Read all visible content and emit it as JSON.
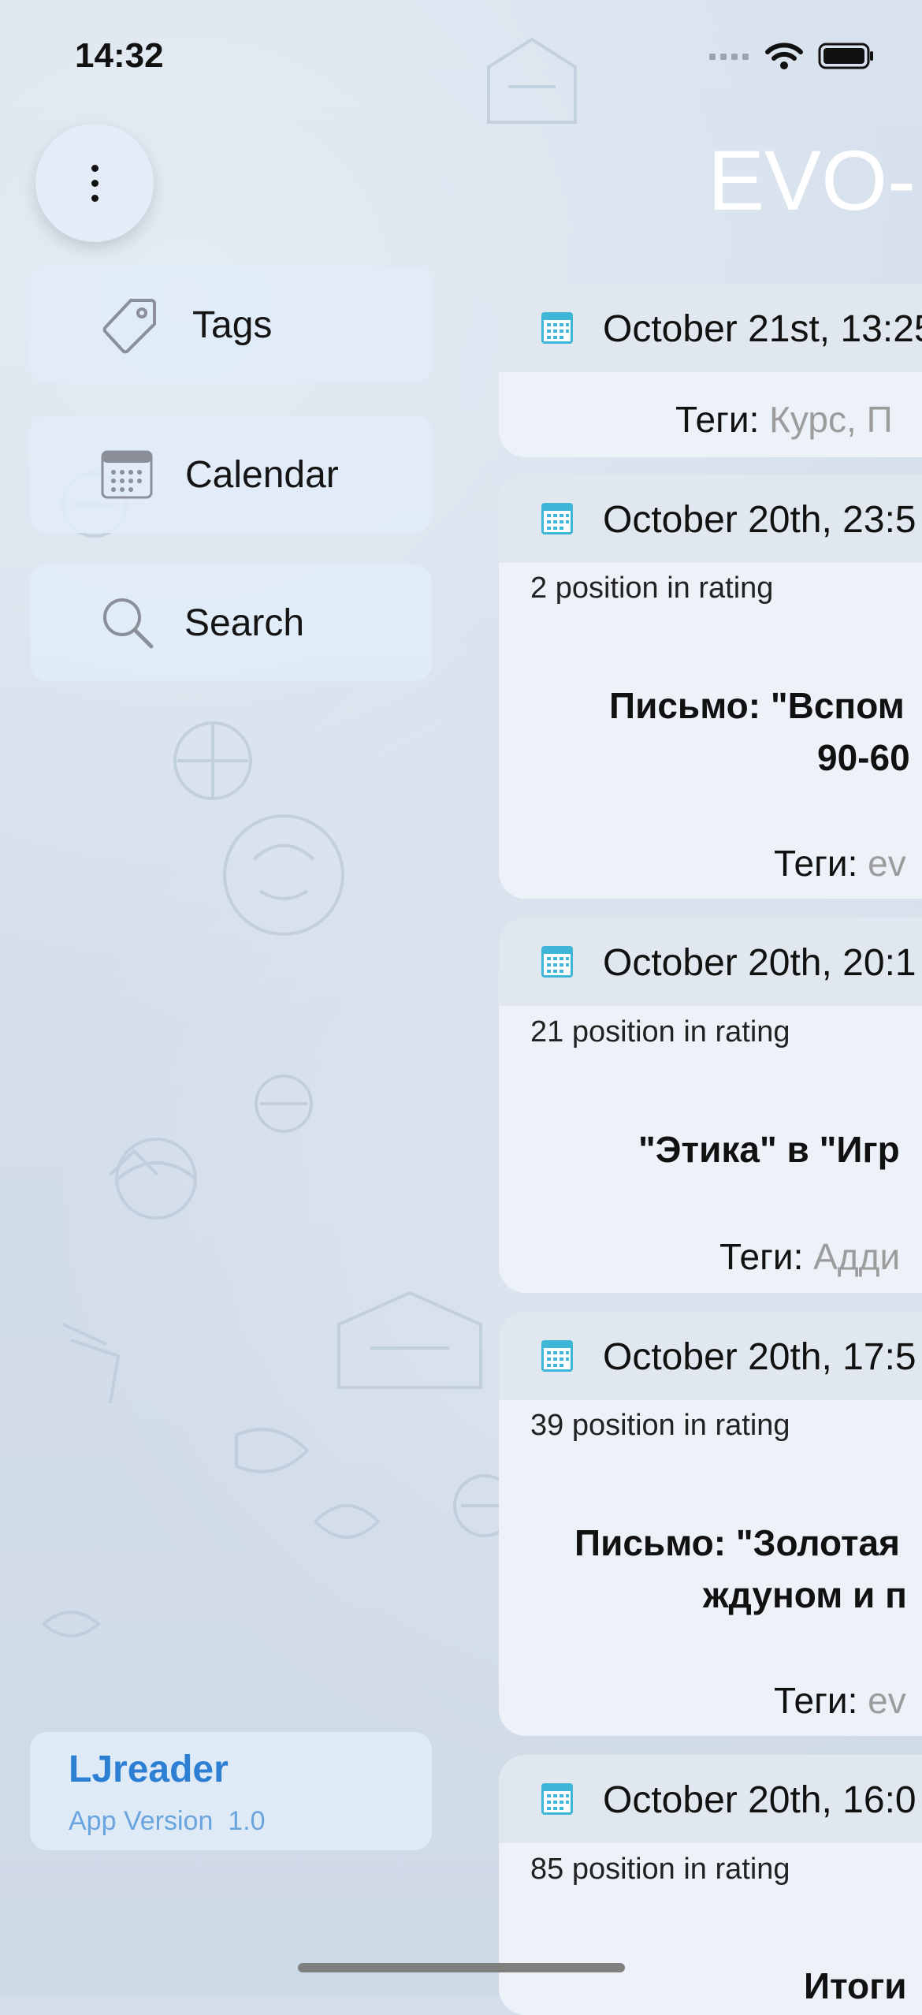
{
  "status": {
    "time": "14:32"
  },
  "header": {
    "title": "EVO-L"
  },
  "menu_button": {
    "icon": "more-vertical-icon"
  },
  "sidebar": {
    "items": [
      {
        "label": "Tags",
        "icon": "tag-icon"
      },
      {
        "label": "Calendar",
        "icon": "calendar-icon"
      },
      {
        "label": "Search",
        "icon": "search-icon"
      }
    ]
  },
  "footer": {
    "app_name": "LJreader",
    "version_label": "App Version",
    "version_number": "1.0"
  },
  "posts": [
    {
      "date": "October 21st, 13:25",
      "tags_label": "Теги:",
      "tags_value": "Курс, П"
    },
    {
      "date": "October 20th, 23:5",
      "rating": "2 position in rating",
      "title_line1": "Письмо: \"Вспом",
      "title_line2": "90-60",
      "tags_label": "Теги:",
      "tags_value": "ev"
    },
    {
      "date": "October 20th, 20:1",
      "rating": "21 position in rating",
      "title_line1": "\"Этика\" в \"Игр",
      "tags_label": "Теги:",
      "tags_value": "Адди"
    },
    {
      "date": "October 20th, 17:5",
      "rating": "39 position in rating",
      "title_line1": "Письмо: \"Золотая",
      "title_line2": "ждуном и п",
      "tags_label": "Теги:",
      "tags_value": "ev"
    },
    {
      "date": "October 20th, 16:0",
      "rating": "85 position in rating",
      "title_line1": "Итоги"
    }
  ]
}
